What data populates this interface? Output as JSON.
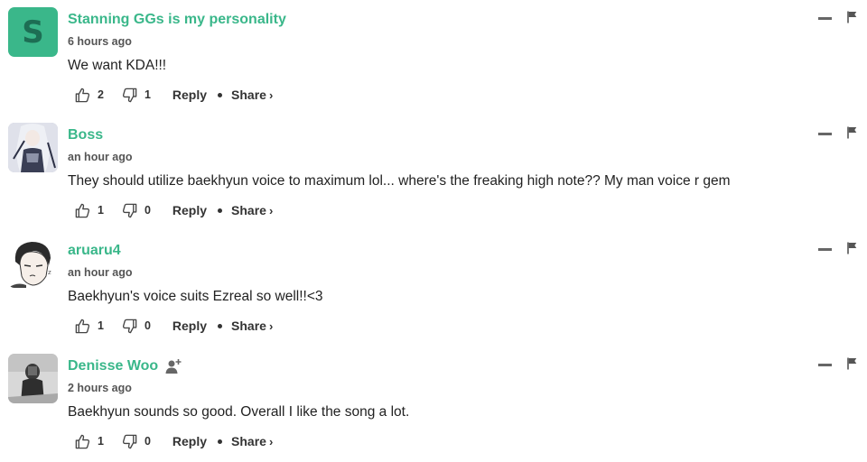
{
  "comments": [
    {
      "username": "Stanning GGs is my personality",
      "avatar_letter": "S",
      "timestamp": "6 hours ago",
      "text": "We want KDA!!!",
      "upvotes": "2",
      "downvotes": "1",
      "reply_label": "Reply",
      "share_label": "Share",
      "share_chevron": "›"
    },
    {
      "username": "Boss",
      "timestamp": "an hour ago",
      "text": "They should utilize baekhyun voice to maximum lol... where's the freaking high note?? My man voice r gem",
      "upvotes": "1",
      "downvotes": "0",
      "reply_label": "Reply",
      "share_label": "Share",
      "share_chevron": "›"
    },
    {
      "username": "aruaru4",
      "timestamp": "an hour ago",
      "text": "Baekhyun's voice suits Ezreal so well!!<3",
      "upvotes": "1",
      "downvotes": "0",
      "reply_label": "Reply",
      "share_label": "Share",
      "share_chevron": "›"
    },
    {
      "username": "Denisse Woo",
      "timestamp": "2 hours ago",
      "text": "Baekhyun sounds so good. Overall I like the song a lot.",
      "upvotes": "1",
      "downvotes": "0",
      "reply_label": "Reply",
      "share_label": "Share",
      "share_chevron": "›"
    }
  ],
  "colors": {
    "username": "#3ab78a",
    "avatar_bg": "#3ab78a",
    "text": "#222222",
    "muted": "#555555"
  },
  "icons": [
    "thumbs-up-icon",
    "thumbs-down-icon",
    "collapse-icon",
    "flag-icon",
    "follow-user-icon"
  ]
}
